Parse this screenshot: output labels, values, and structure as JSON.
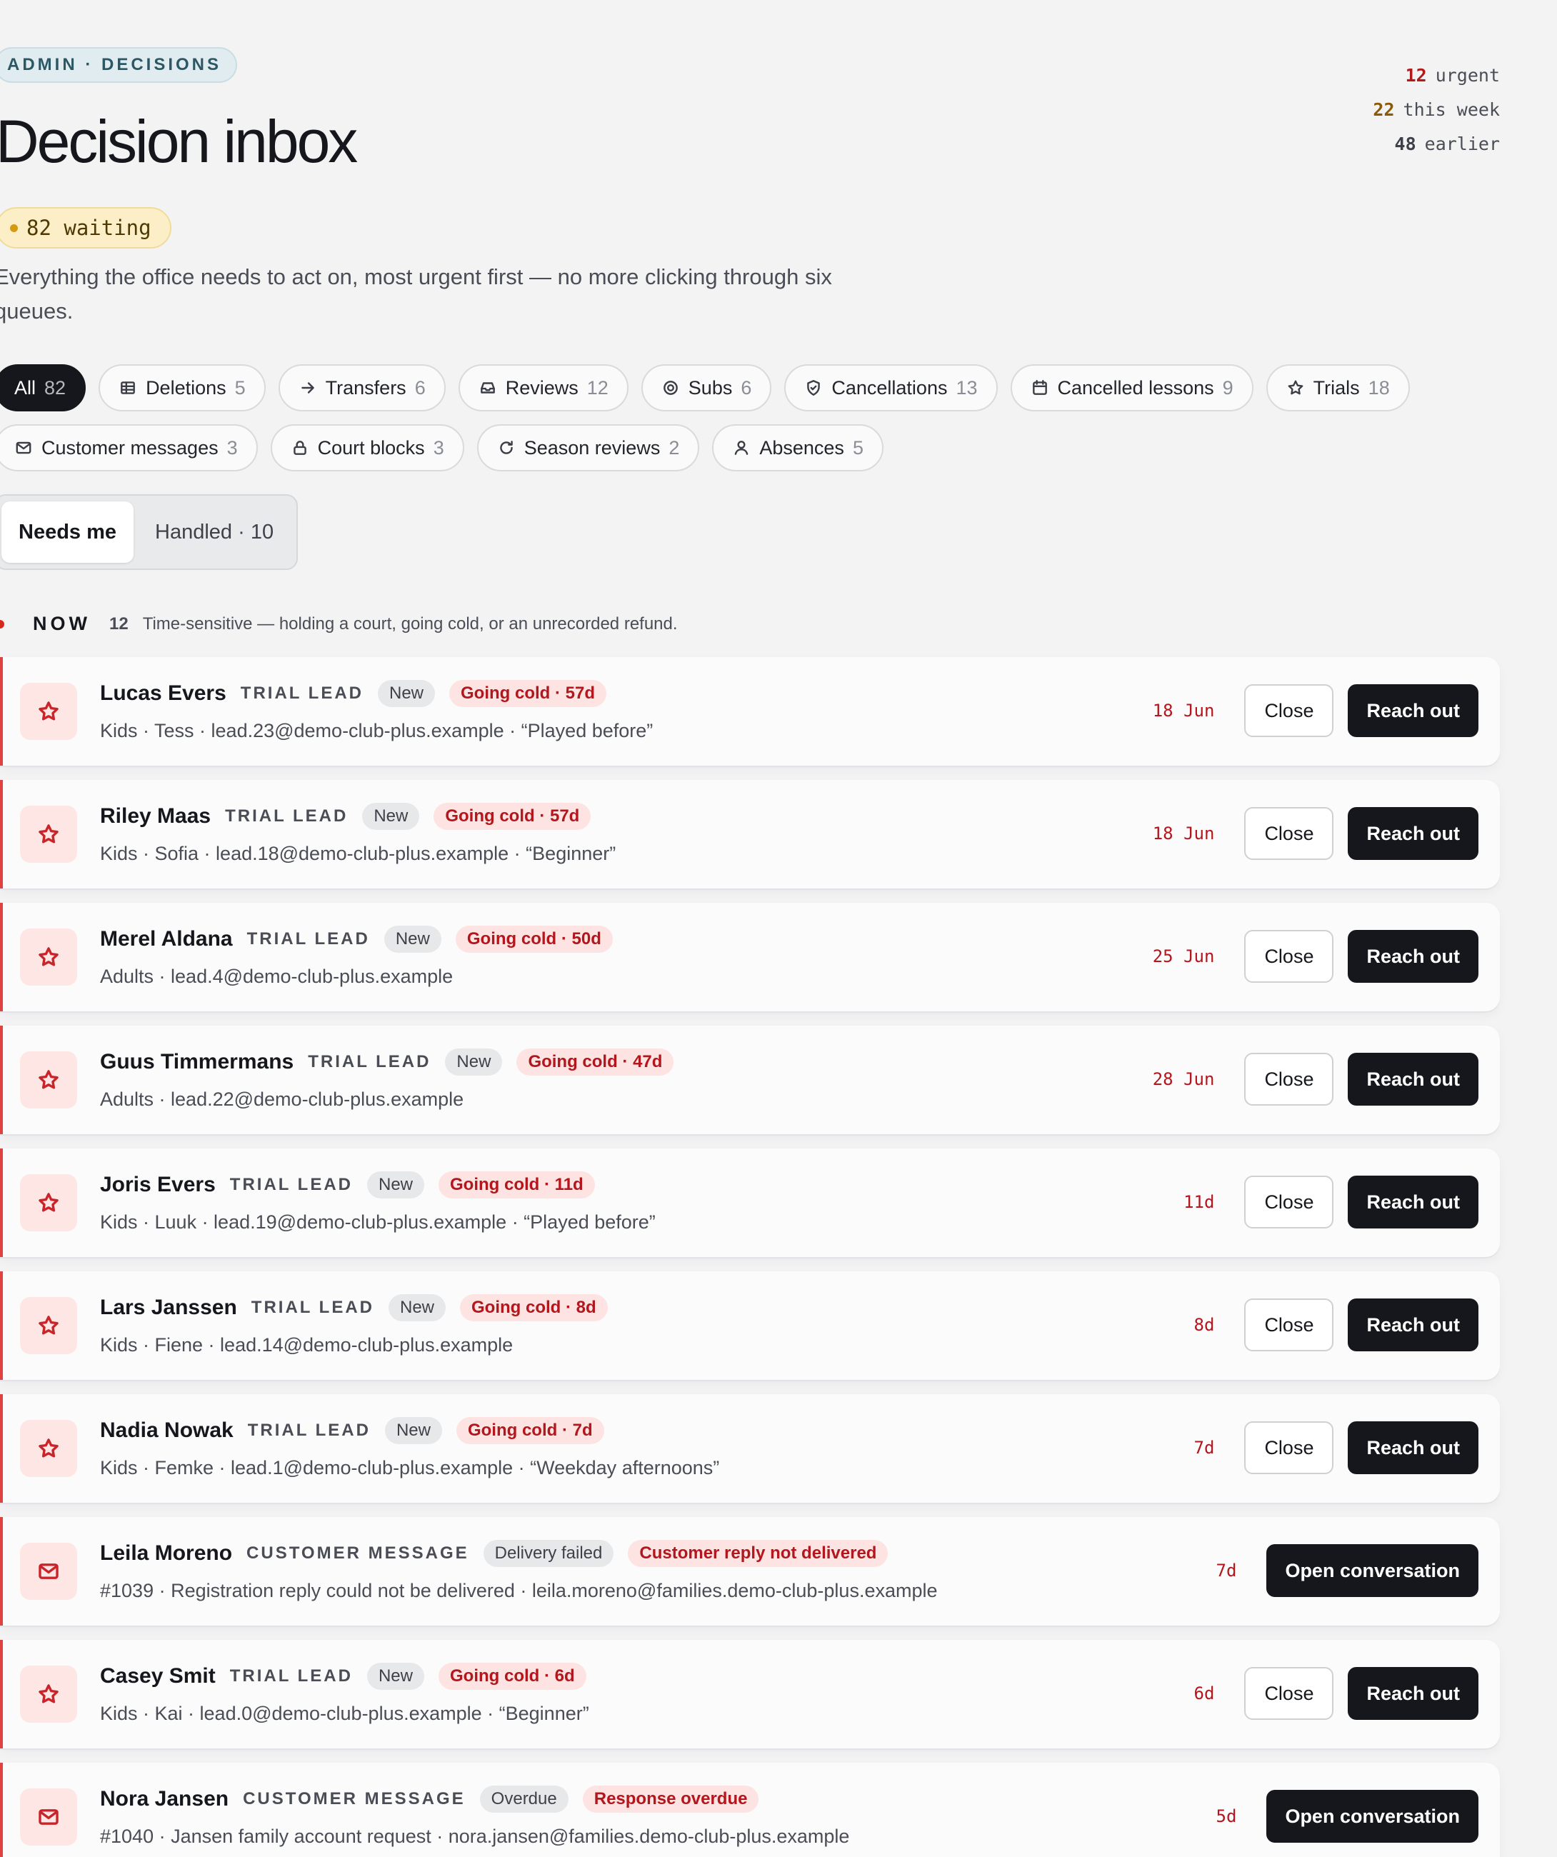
{
  "header": {
    "eyebrow": "ADMIN · DECISIONS",
    "title": "Decision inbox",
    "waiting": "82 waiting",
    "subtitle": "Everything the office needs to act on, most urgent first — no more clicking through six queues."
  },
  "stats": [
    {
      "count": "12",
      "label": "urgent",
      "tone": "red"
    },
    {
      "count": "22",
      "label": "this week",
      "tone": "amber"
    },
    {
      "count": "48",
      "label": "earlier",
      "tone": "grey"
    }
  ],
  "filters": {
    "row1": [
      {
        "label": "All",
        "count": "82",
        "icon": "none",
        "active": true
      },
      {
        "label": "Deletions",
        "count": "5",
        "icon": "grid-icon"
      },
      {
        "label": "Transfers",
        "count": "6",
        "icon": "arrow-right-icon"
      },
      {
        "label": "Reviews",
        "count": "12",
        "icon": "inbox-icon"
      },
      {
        "label": "Subs",
        "count": "6",
        "icon": "target-icon"
      },
      {
        "label": "Cancellations",
        "count": "13",
        "icon": "shield-check-icon"
      },
      {
        "label": "Cancelled lessons",
        "count": "9",
        "icon": "calendar-icon"
      },
      {
        "label": "Trials",
        "count": "18",
        "icon": "star-icon"
      }
    ],
    "row2": [
      {
        "label": "Customer messages",
        "count": "3",
        "icon": "mail-icon"
      },
      {
        "label": "Court blocks",
        "count": "3",
        "icon": "lock-icon"
      },
      {
        "label": "Season reviews",
        "count": "2",
        "icon": "refresh-icon"
      },
      {
        "label": "Absences",
        "count": "5",
        "icon": "user-icon"
      }
    ]
  },
  "segment": {
    "needs_me": "Needs me",
    "handled": "Handled · 10"
  },
  "section": {
    "label": "NOW",
    "count": "12",
    "description": "Time-sensitive — holding a court, going cold, or an unrecorded refund."
  },
  "buttons": {
    "close": "Close",
    "reach_out": "Reach out",
    "open_conversation": "Open conversation"
  },
  "items": [
    {
      "name": "Lucas Evers",
      "kind": "TRIAL LEAD",
      "status": "New",
      "alert": "Going cold · 57d",
      "details": "Kids · Tess · lead.23@demo-club-plus.example · “Played before”",
      "date": "18 Jun",
      "icon": "star-icon"
    },
    {
      "name": "Riley Maas",
      "kind": "TRIAL LEAD",
      "status": "New",
      "alert": "Going cold · 57d",
      "details": "Kids · Sofia · lead.18@demo-club-plus.example · “Beginner”",
      "date": "18 Jun",
      "icon": "star-icon"
    },
    {
      "name": "Merel Aldana",
      "kind": "TRIAL LEAD",
      "status": "New",
      "alert": "Going cold · 50d",
      "details": "Adults · lead.4@demo-club-plus.example",
      "date": "25 Jun",
      "icon": "star-icon"
    },
    {
      "name": "Guus Timmermans",
      "kind": "TRIAL LEAD",
      "status": "New",
      "alert": "Going cold · 47d",
      "details": "Adults · lead.22@demo-club-plus.example",
      "date": "28 Jun",
      "icon": "star-icon"
    },
    {
      "name": "Joris Evers",
      "kind": "TRIAL LEAD",
      "status": "New",
      "alert": "Going cold · 11d",
      "details": "Kids · Luuk · lead.19@demo-club-plus.example · “Played before”",
      "date": "11d",
      "icon": "star-icon"
    },
    {
      "name": "Lars Janssen",
      "kind": "TRIAL LEAD",
      "status": "New",
      "alert": "Going cold · 8d",
      "details": "Kids · Fiene · lead.14@demo-club-plus.example",
      "date": "8d",
      "icon": "star-icon"
    },
    {
      "name": "Nadia Nowak",
      "kind": "TRIAL LEAD",
      "status": "New",
      "alert": "Going cold · 7d",
      "details": "Kids · Femke · lead.1@demo-club-plus.example · “Weekday afternoons”",
      "date": "7d",
      "icon": "star-icon"
    },
    {
      "name": "Leila Moreno",
      "kind": "CUSTOMER MESSAGE",
      "status": "Delivery failed",
      "alert": "Customer reply not delivered",
      "details": "#1039 · Registration reply could not be delivered · leila.moreno@families.demo-club-plus.example",
      "date": "7d",
      "icon": "mail-icon"
    },
    {
      "name": "Casey Smit",
      "kind": "TRIAL LEAD",
      "status": "New",
      "alert": "Going cold · 6d",
      "details": "Kids · Kai · lead.0@demo-club-plus.example · “Beginner”",
      "date": "6d",
      "icon": "star-icon"
    },
    {
      "name": "Nora Jansen",
      "kind": "CUSTOMER MESSAGE",
      "status": "Overdue",
      "alert": "Response overdue",
      "details": "#1040 · Jansen family account request · nora.jansen@families.demo-club-plus.example",
      "date": "5d",
      "icon": "mail-icon"
    }
  ]
}
